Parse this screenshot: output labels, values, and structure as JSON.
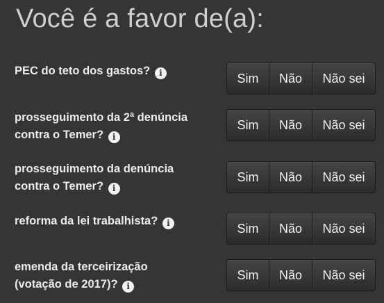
{
  "title": "Você é a favor de(a):",
  "info_glyph": "i",
  "buttons": {
    "yes": "Sim",
    "no": "Não",
    "unsure": "Não sei"
  },
  "questions": [
    {
      "line1": "PEC do teto dos gastos?",
      "line2": ""
    },
    {
      "line1": "prosseguimento da 2ª denúncia",
      "line2": "contra o Temer?"
    },
    {
      "line1": "prosseguimento da denúncia",
      "line2": "contra o Temer?"
    },
    {
      "line1": "reforma da lei trabalhista?",
      "line2": ""
    },
    {
      "line1": "emenda da terceirização",
      "line2": "(votação de 2017)?"
    }
  ]
}
